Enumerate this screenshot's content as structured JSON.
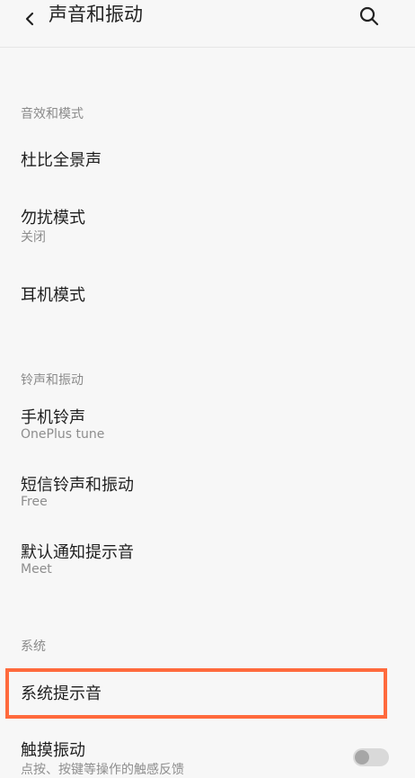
{
  "header": {
    "title": "声音和振动",
    "back_icon": "chevron-left-icon",
    "search_icon": "search-icon"
  },
  "sections": {
    "sound_effects": {
      "header": "音效和模式",
      "items": [
        {
          "title": "杜比全景声"
        },
        {
          "title": "勿扰模式",
          "subtitle": "关闭"
        },
        {
          "title": "耳机模式"
        }
      ]
    },
    "ringtones": {
      "header": "铃声和振动",
      "items": [
        {
          "title": "手机铃声",
          "subtitle": "OnePlus tune"
        },
        {
          "title": "短信铃声和振动",
          "subtitle": "Free"
        },
        {
          "title": "默认通知提示音",
          "subtitle": "Meet"
        }
      ]
    },
    "system": {
      "header": "系统",
      "items": [
        {
          "title": "系统提示音"
        },
        {
          "title": "触摸振动",
          "subtitle": "点按、按键等操作的触感反馈",
          "toggle": "off"
        }
      ]
    }
  },
  "colors": {
    "highlight": "#ff6a3d",
    "background": "#f7f7f7"
  }
}
